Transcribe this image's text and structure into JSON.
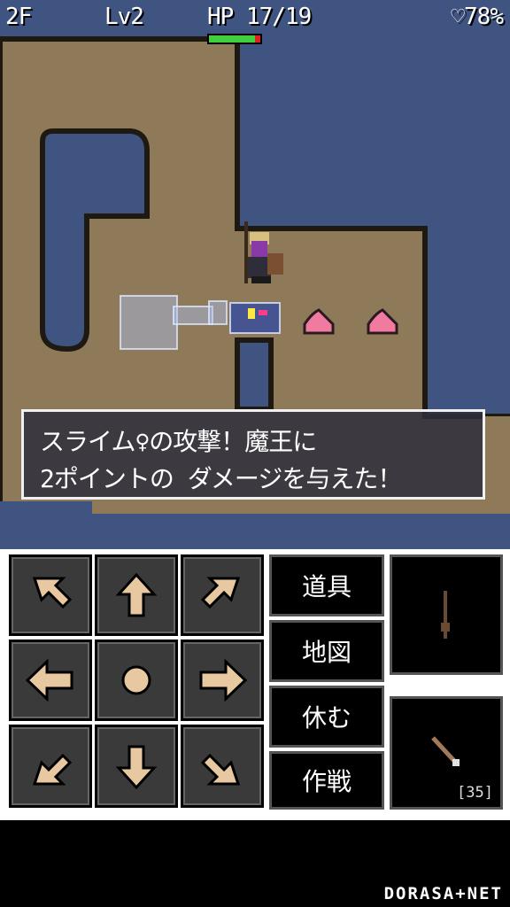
{
  "hud": {
    "floor": "2F",
    "level": "Lv2",
    "hp": "HP 17/19",
    "heart": "♡78%",
    "hp_fraction": 0.895
  },
  "message": {
    "line1": "スライム♀の攻撃！魔王に",
    "line2": "2ポイントの ダメージを与えた！"
  },
  "dpad": [
    "up-left",
    "up",
    "up-right",
    "left",
    "wait",
    "right",
    "down-left",
    "down",
    "down-right"
  ],
  "commands": {
    "items": "道具",
    "map": "地図",
    "rest": "休む",
    "tactics": "作戦"
  },
  "slots": {
    "weapon": "staff-icon",
    "arrow": "arrow-icon",
    "arrow_count": "[35]"
  },
  "footer": {
    "logo": "DORASA+NET"
  },
  "colors": {
    "water": "#3f5480",
    "floor": "#8e7a58",
    "button": "#3a3a3a",
    "arrow": "#e8c8a0"
  }
}
